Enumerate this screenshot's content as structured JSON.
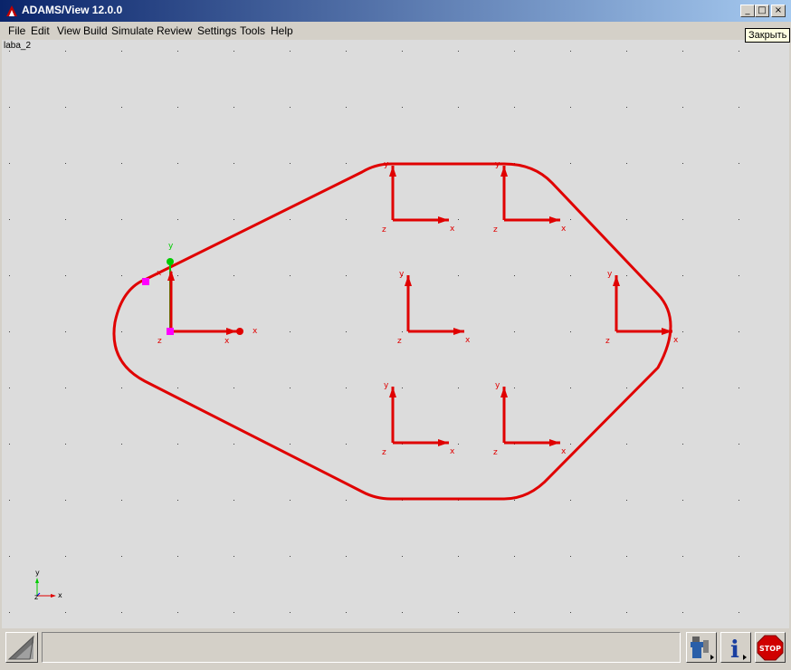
{
  "window": {
    "title": "ADAMS/View 12.0.0",
    "minimize_glyph": "_",
    "maximize_glyph": "□",
    "close_glyph": "×",
    "close_tooltip": "Закрыть"
  },
  "menu": [
    {
      "label": "File"
    },
    {
      "label": "Edit"
    },
    {
      "label": "View"
    },
    {
      "label": "Build"
    },
    {
      "label": "Simulate"
    },
    {
      "label": "Review"
    },
    {
      "label": "Settings"
    },
    {
      "label": "Tools"
    },
    {
      "label": "Help"
    }
  ],
  "viewport": {
    "model_name": "laba_2",
    "axis_x_label": "x",
    "axis_y_label": "y",
    "axis_z_label": "z",
    "stop_label": "STOP",
    "info_label": "i"
  },
  "colors": {
    "geometry": "#e00000",
    "marker_highlight": "#ff00ff",
    "selection_green": "#00cc00",
    "triad_blue": "#0000ff"
  },
  "icons": [
    "adams-logo-icon",
    "toolbox-icon",
    "info-icon",
    "stop-icon"
  ]
}
